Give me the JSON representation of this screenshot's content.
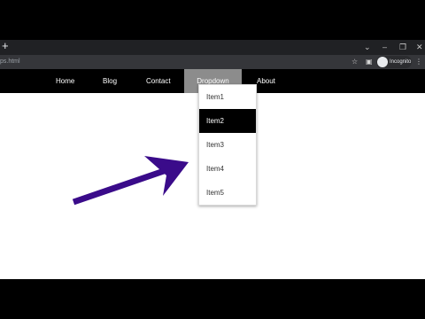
{
  "browser": {
    "new_tab_label": "+",
    "window_controls": [
      "⌄",
      "–",
      "❐",
      "✕"
    ],
    "url": "ps.html",
    "profile_label": "Incognito"
  },
  "nav": {
    "items": [
      "Home",
      "Blog",
      "Contact",
      "Dropdown",
      "About"
    ]
  },
  "dropdown": {
    "items": [
      "Item1",
      "Item2",
      "Item3",
      "Item4",
      "Item5"
    ],
    "active_index": 1
  },
  "colors": {
    "arrow": "#3a0b8a",
    "navbar": "#000000",
    "dropdown_active_bg": "#8c8c8c"
  },
  "icons": {
    "star": "star-icon",
    "sidepanel": "sidepanel-icon",
    "incognito": "incognito-icon",
    "menu": "kebab-menu-icon",
    "arrow": "annotation-arrow-icon"
  }
}
